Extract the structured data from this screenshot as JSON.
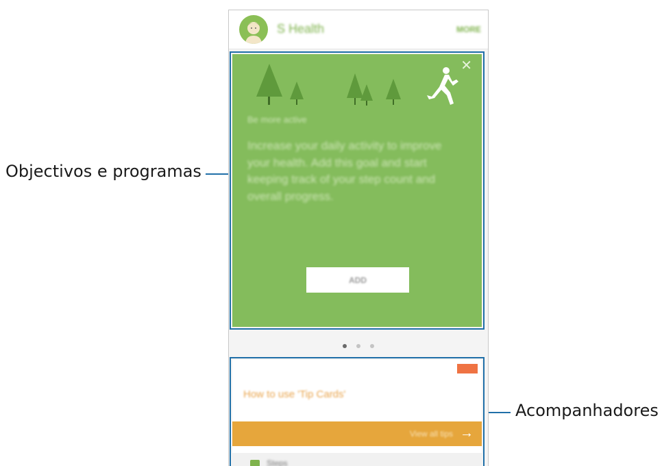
{
  "callouts": {
    "goals_label": "Objectivos e programas",
    "trackers_label": "Acompanhadores"
  },
  "header": {
    "title": "S Health",
    "more_label": "MORE",
    "avatar_icon": "avatar-icon"
  },
  "goal_card": {
    "subtitle": "Be more active",
    "description": "Increase your daily activity to improve your health. Add this goal and start keeping track of your step count and overall progress.",
    "add_label": "ADD",
    "close_glyph": "✕",
    "background_color": "#84bc5c"
  },
  "pager": {
    "total": 3,
    "active_index": 0
  },
  "tip_card": {
    "title": "How to use 'Tip Cards'",
    "view_all_label": "View all tips",
    "arrow_glyph": "→",
    "accent_color": "#e6a63c",
    "badge_color": "#ef7343"
  },
  "tracker": {
    "label": "Steps",
    "icon": "steps-icon"
  }
}
